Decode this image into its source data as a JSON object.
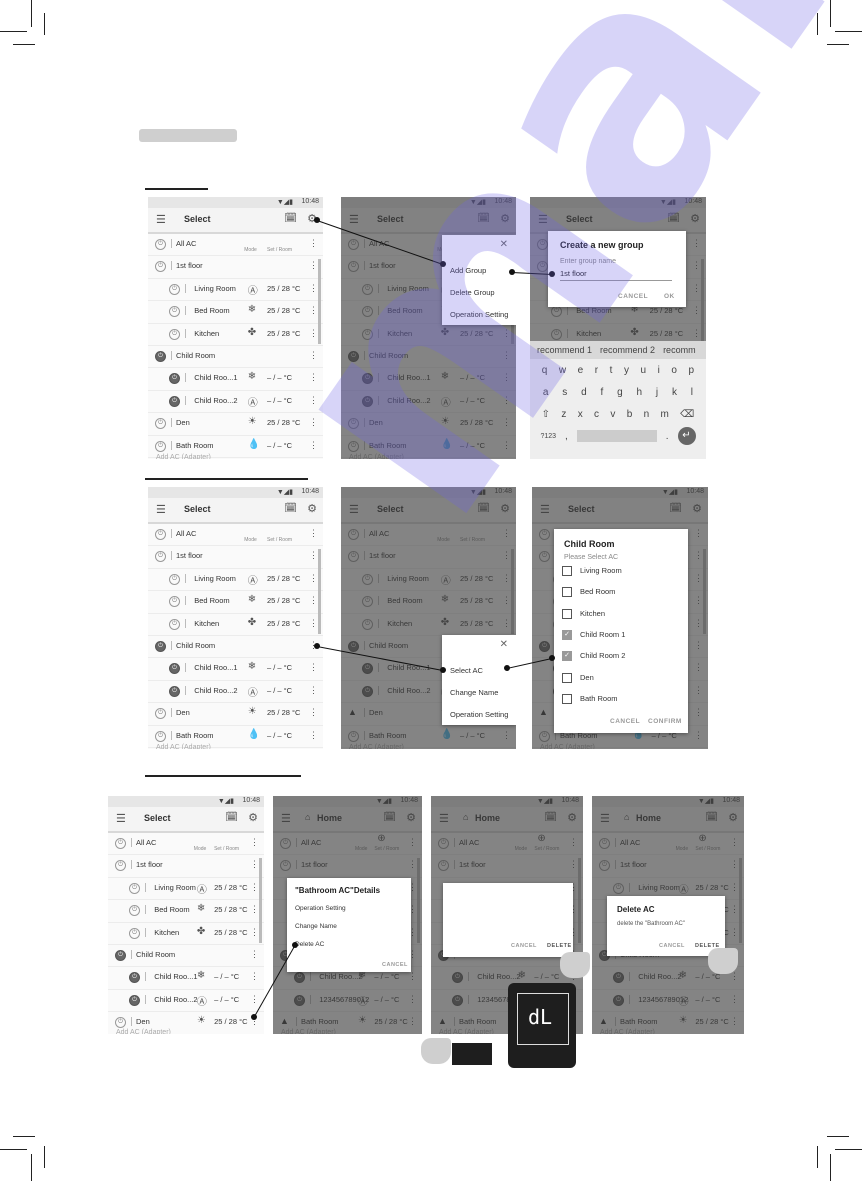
{
  "status_time": "10:48",
  "signal_icons": "wifi signal battery",
  "select_title": "Select",
  "home_title": "Home",
  "col_mode": "Mode",
  "col_set_room": "Set / Room",
  "footer": "Add AC (Adapter)",
  "rows": [
    {
      "name": "All AC",
      "mode": "",
      "temp": "",
      "level": 0,
      "dark": false,
      "header": true
    },
    {
      "name": "1st floor",
      "mode": "",
      "temp": "",
      "level": 0,
      "dark": false
    },
    {
      "name": "Living Room",
      "mode": "Ⓐ",
      "temp": "25 / 28 °C",
      "level": 1,
      "dark": false
    },
    {
      "name": "Bed Room",
      "mode": "❄",
      "temp": "25 / 28 °C",
      "level": 1,
      "dark": false
    },
    {
      "name": "Kitchen",
      "mode": "✤",
      "temp": "25 / 28 °C",
      "level": 1,
      "dark": false
    },
    {
      "name": "Child Room",
      "mode": "",
      "temp": "",
      "level": 0,
      "dark": true
    },
    {
      "name": "Child Roo...1",
      "mode": "❄",
      "temp": "– / –  °C",
      "level": 1,
      "dark": true
    },
    {
      "name": "Child Roo...2",
      "mode": "Ⓐ",
      "temp": "– / –  °C",
      "level": 1,
      "dark": true
    },
    {
      "name": "Den",
      "mode": "☀",
      "temp": "25 / 28 °C",
      "level": 0,
      "dark": false
    },
    {
      "name": "Bath Room",
      "mode": "💧",
      "temp": "– / –  °C",
      "level": 0,
      "dark": false
    }
  ],
  "menu1": {
    "items": [
      "Add Group",
      "Delete Group",
      "Operation Setting"
    ]
  },
  "create_group": {
    "title": "Create a new group",
    "label": "Enter group name",
    "value": "1st floor",
    "cancel": "CANCEL",
    "ok": "OK"
  },
  "keyboard": {
    "suggestions": [
      "recommend 1",
      "recommend 2",
      "recomm"
    ],
    "row1": [
      "q",
      "w",
      "e",
      "r",
      "t",
      "y",
      "u",
      "i",
      "o",
      "p"
    ],
    "row2": [
      "a",
      "s",
      "d",
      "f",
      "g",
      "h",
      "j",
      "k",
      "l"
    ],
    "row3": [
      "⇧",
      "z",
      "x",
      "c",
      "v",
      "b",
      "n",
      "m",
      "⌫"
    ],
    "sym": "?123",
    "comma": ",",
    "period": ".",
    "enter": "↵"
  },
  "menu2": {
    "items": [
      "Select AC",
      "Change Name",
      "Operation Setting"
    ]
  },
  "select_ac": {
    "title": "Child Room",
    "subtitle": "Please Select AC",
    "items": [
      {
        "label": "Living Room",
        "checked": false
      },
      {
        "label": "Bed Room",
        "checked": false
      },
      {
        "label": "Kitchen",
        "checked": false
      },
      {
        "label": "Child Room 1",
        "checked": true
      },
      {
        "label": "Child Room 2",
        "checked": true
      },
      {
        "label": "Den",
        "checked": false
      },
      {
        "label": "Bath Room",
        "checked": false
      }
    ],
    "cancel": "CANCEL",
    "confirm": "CONFIRM"
  },
  "details": {
    "title": "\"Bathroom  AC\"Details",
    "items": [
      "Operation Setting",
      "Change Name",
      "Delete AC"
    ],
    "cancel": "CANCEL"
  },
  "delete_blank": {
    "cancel": "CANCEL",
    "delete": "DELETE"
  },
  "delete_confirm": {
    "title": "Delete AC",
    "message": "delete the \"Bathroom AC\"",
    "cancel": "CANCEL",
    "delete": "DELETE"
  },
  "home_rows": [
    "All AC",
    "1st floor",
    "Living Room",
    "",
    "",
    "",
    "Child Roo...2",
    "123456789012",
    "Bath Room"
  ],
  "display_code": "dL",
  "watermark": "manuals"
}
